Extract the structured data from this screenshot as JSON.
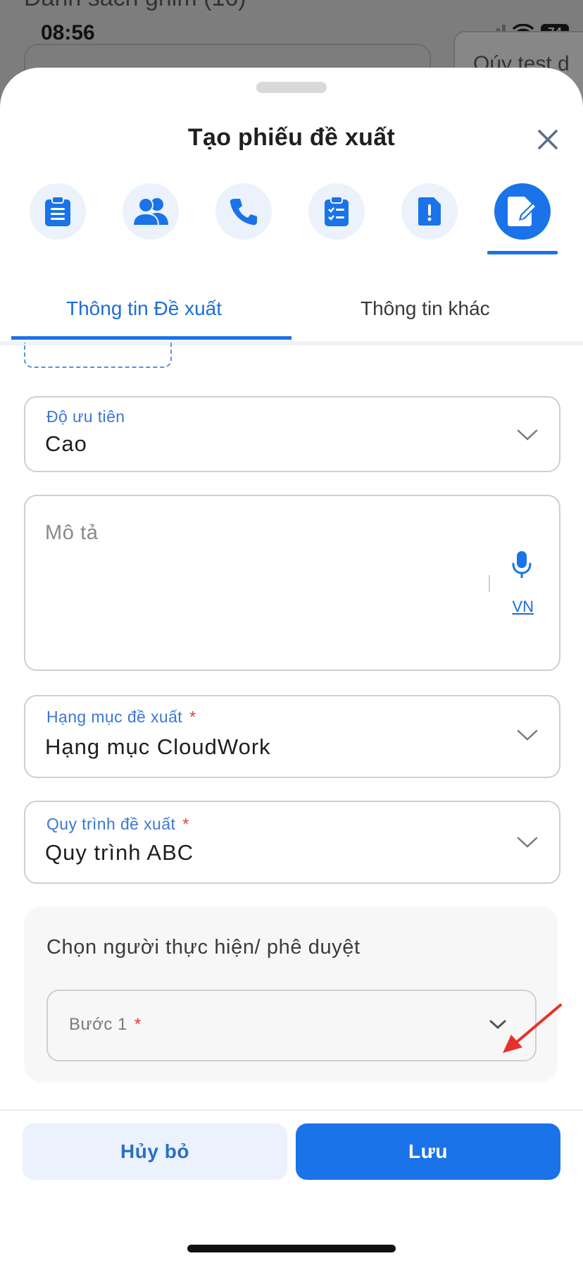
{
  "status_bar": {
    "time": "08:56",
    "battery": "74"
  },
  "background": {
    "title": "Danh sách ghim (16)",
    "card_text": "Qúy test d"
  },
  "sheet": {
    "title": "Tạo phiếu đề xuất",
    "type_icons": [
      {
        "name": "clipboard-icon",
        "active": false
      },
      {
        "name": "users-icon",
        "active": false
      },
      {
        "name": "phone-icon",
        "active": false
      },
      {
        "name": "checklist-icon",
        "active": false
      },
      {
        "name": "alert-document-icon",
        "active": false
      },
      {
        "name": "edit-document-icon",
        "active": true
      }
    ],
    "tabs": [
      {
        "label": "Thông tin Đề xuất",
        "active": true
      },
      {
        "label": "Thông tin khác",
        "active": false
      }
    ]
  },
  "form": {
    "priority": {
      "label": "Độ ưu tiên",
      "value": "Cao"
    },
    "description": {
      "placeholder": "Mô tả",
      "lang": "VN"
    },
    "category": {
      "label": "Hạng mục đề xuất",
      "required": "*",
      "value": "Hạng mục CloudWork"
    },
    "process": {
      "label": "Quy trình đề xuất",
      "required": "*",
      "value": "Quy trình ABC"
    },
    "approval": {
      "title": "Chọn người thực hiện/ phê duyệt",
      "step_label": "Bước 1",
      "step_required": "*"
    }
  },
  "buttons": {
    "cancel": "Hủy bỏ",
    "save": "Lưu"
  },
  "colors": {
    "accent": "#1a73e8",
    "label": "#3a78d6",
    "required": "#e53935",
    "annotation_arrow": "#e8302b"
  }
}
